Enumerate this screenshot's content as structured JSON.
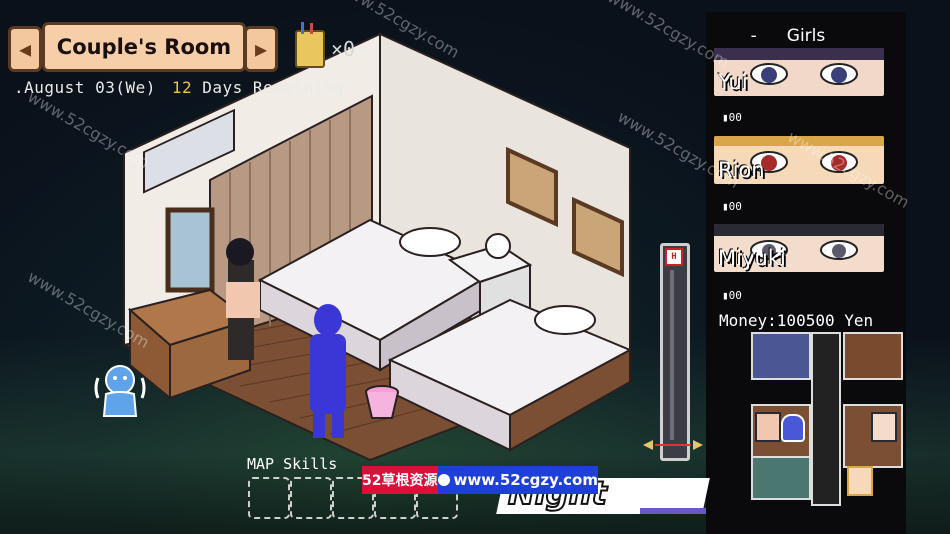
{
  "location": {
    "room_name": "Couple's Room",
    "prev_arrow": "◀",
    "next_arrow": "▶"
  },
  "inventory": {
    "item_icon": "pencil-cup-icon",
    "item_count": "×0"
  },
  "date": {
    "date_text": ".August 03(We)",
    "days_number": "12",
    "days_label": "Days Remaining"
  },
  "panel": {
    "header_dash": "-",
    "header_title": "Girls",
    "girls": [
      {
        "name": "Yui",
        "status": "▮00",
        "eye_color": "#3a3f7a",
        "skin": "#f1d8c8",
        "hair": "#3b2f4e"
      },
      {
        "name": "Rion",
        "status": "▮00",
        "eye_color": "#a52a2a",
        "skin": "#f5d9b8",
        "hair": "#d9a64a"
      },
      {
        "name": "Miyuki",
        "status": "▮00",
        "eye_color": "#5a5a6a",
        "skin": "#f3dccc",
        "hair": "#2a2a35"
      }
    ],
    "money": "Money:100500 Yen"
  },
  "time_slider": {
    "top_icon": "H"
  },
  "bottom": {
    "map_skills_label": "MAP Skills",
    "time_of_day": "Night"
  },
  "banner": {
    "site_cn": "52草根资源",
    "site_url": "www.52cgzy.com"
  },
  "watermark_text": "www.52cgzy.com",
  "colors": {
    "plate_fill": "#f6cfa8",
    "plate_border": "#5a3a22",
    "accent_yellow": "#f2c14e",
    "slider_red": "#dd3333"
  }
}
